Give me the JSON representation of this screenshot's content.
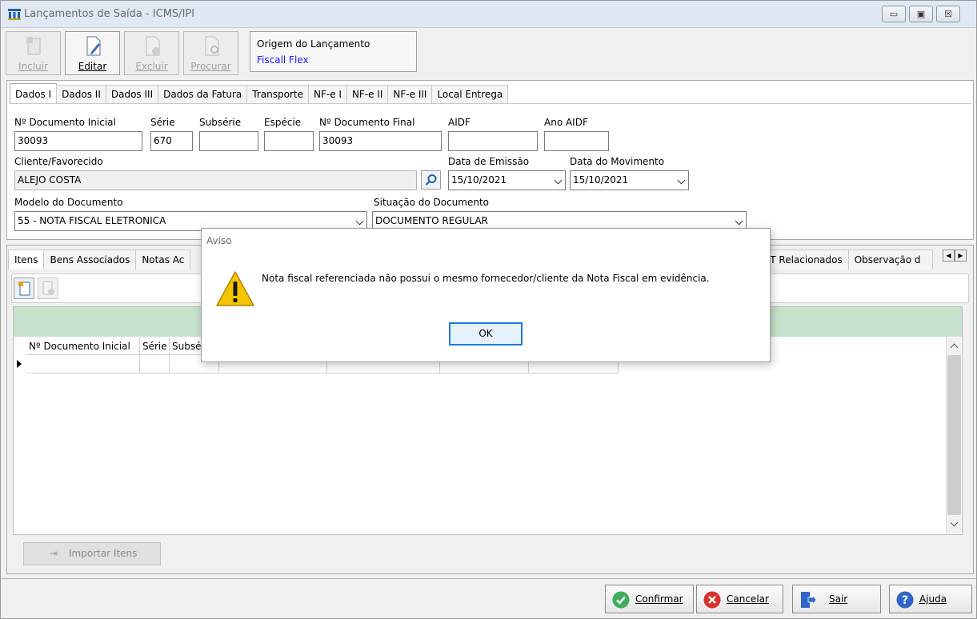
{
  "window": {
    "title": "Lançamentos de Saída - ICMS/IPI",
    "controls": {
      "minimize": "▭",
      "maximize": "▣",
      "close": "☒"
    }
  },
  "toolbar": {
    "incluir": "Incluir",
    "editar": "Editar",
    "excluir": "Excluir",
    "procurar": "Procurar"
  },
  "origem": {
    "title": "Origem do Lançamento",
    "value": "Fiscall Flex"
  },
  "tabs": [
    "Dados I",
    "Dados II",
    "Dados III",
    "Dados da Fatura",
    "Transporte",
    "NF-e I",
    "NF-e II",
    "NF-e III",
    "Local Entrega"
  ],
  "form": {
    "doc_inicial": {
      "label": "Nº Documento Inicial",
      "value": "30093"
    },
    "serie": {
      "label": "Série",
      "value": "670"
    },
    "subserie": {
      "label": "Subsérie",
      "value": ""
    },
    "especie": {
      "label": "Espécie",
      "value": ""
    },
    "doc_final": {
      "label": "Nº Documento Final",
      "value": "30093"
    },
    "aidf": {
      "label": "AIDF",
      "value": ""
    },
    "ano_aidf": {
      "label": "Ano AIDF",
      "value": ""
    },
    "cliente": {
      "label": "Cliente/Favorecido",
      "value": "ALEJO COSTA"
    },
    "data_emissao": {
      "label": "Data de Emissão",
      "value": "15/10/2021"
    },
    "data_movimento": {
      "label": "Data do Movimento",
      "value": "15/10/2021"
    },
    "modelo": {
      "label": "Modelo do Documento",
      "value": "55 - NOTA FISCAL ELETRONICA"
    },
    "situacao": {
      "label": "Situação do Documento",
      "value": "DOCUMENTO REGULAR"
    }
  },
  "lower_tabs": [
    "Itens",
    "Bens Associados",
    "Notas Ac"
  ],
  "lower_tabs_right": [
    "AT Relacionados",
    "Observação d"
  ],
  "grid": {
    "columns": [
      "Nº Documento Inicial",
      "Série",
      "Subsé"
    ]
  },
  "import_button": "Importar Itens",
  "actions": {
    "confirmar": "Confirmar",
    "cancelar": "Cancelar",
    "sair": "Sair",
    "ajuda": "Ajuda"
  },
  "dialog": {
    "title": "Aviso",
    "message": "Nota fiscal referenciada não possui o mesmo fornecedor/cliente da Nota Fiscal em evidência.",
    "ok": "OK"
  },
  "colors": {
    "link_blue": "#1a1aff",
    "grid_header_green": "#c6e2cc",
    "focus_blue": "#1e78d7",
    "confirm_green": "#3cae5c",
    "cancel_red": "#d9322a",
    "help_blue": "#2f66c7"
  },
  "icons": [
    "app-icon",
    "incluir-icon",
    "editar-icon",
    "excluir-icon",
    "procurar-icon",
    "search-icon",
    "warning-icon",
    "check-icon",
    "x-icon",
    "exit-icon",
    "help-icon"
  ]
}
